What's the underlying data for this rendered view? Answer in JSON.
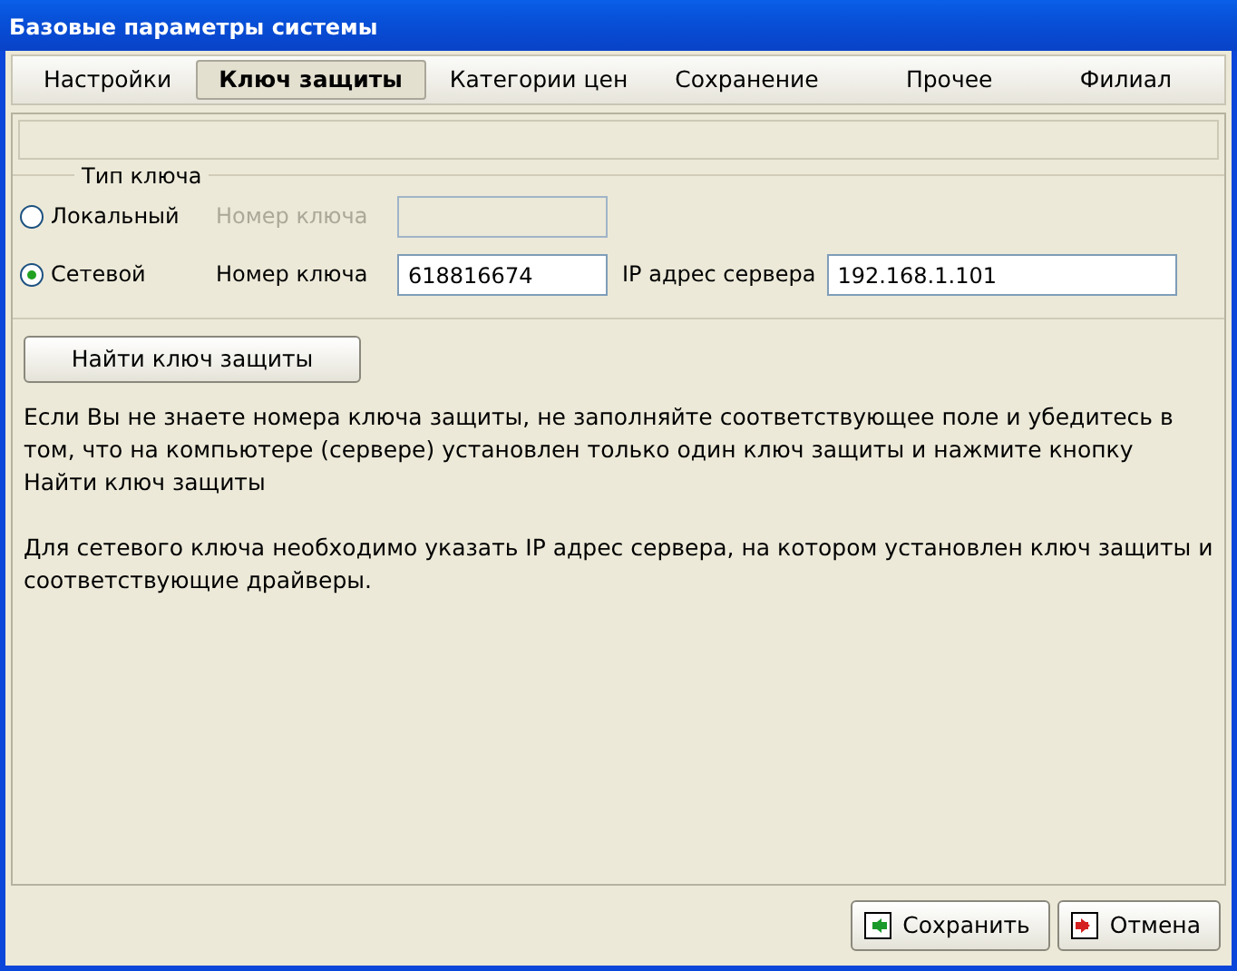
{
  "window": {
    "title": "Базовые параметры системы"
  },
  "tabs": [
    {
      "label": "Настройки",
      "selected": false
    },
    {
      "label": "Ключ защиты",
      "selected": true
    },
    {
      "label": "Категории цен",
      "selected": false
    },
    {
      "label": "Сохранение",
      "selected": false
    },
    {
      "label": "Прочее",
      "selected": false
    },
    {
      "label": "Филиал",
      "selected": false
    }
  ],
  "key_type": {
    "legend": "Тип ключа",
    "options": [
      {
        "label": "Локальный",
        "selected": false,
        "disabled": true,
        "number_label": "Номер ключа"
      },
      {
        "label": "Сетевой",
        "selected": true,
        "disabled": false,
        "number_label": "Номер ключа",
        "number_value": "618816674",
        "ip_label": "IP адрес сервера",
        "ip_value": "192.168.1.101"
      }
    ]
  },
  "find_button": "Найти ключ защиты",
  "paragraphs": [
    "Если Вы не знаете номера ключа защиты, не заполняйте соответствующее поле и убедитесь в том, что на компьютере (сервере) установлен только один ключ защиты и нажмите кнопку Найти ключ защиты",
    "Для сетевого ключа необходимо указать IP адрес сервера, на котором установлен ключ защиты и соответствующие драйверы."
  ],
  "buttons": [
    {
      "kind": "save",
      "label": "Сохранить"
    },
    {
      "kind": "cancel",
      "label": "Отмена"
    }
  ]
}
